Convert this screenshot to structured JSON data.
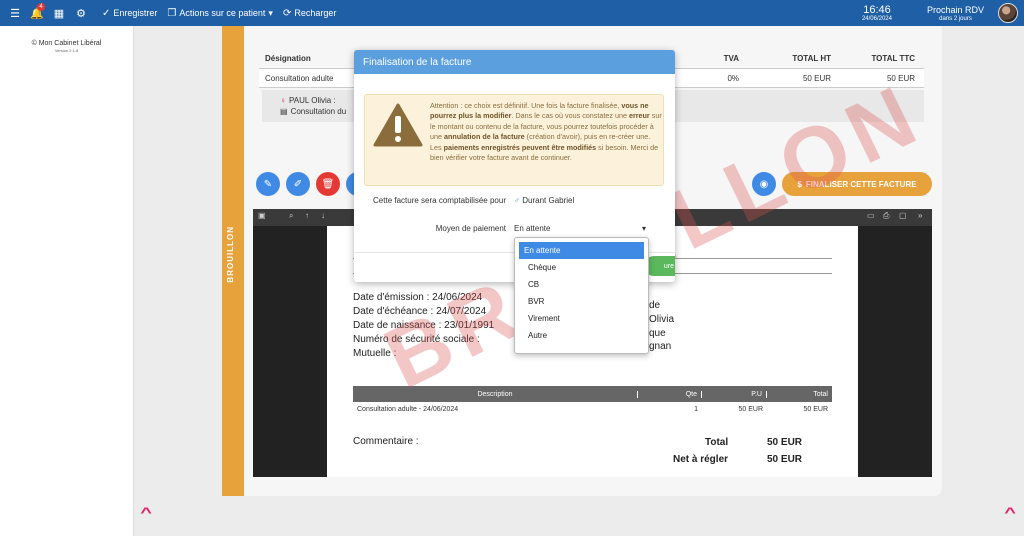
{
  "topbar": {
    "notification_count": "4",
    "save_label": "Enregistrer",
    "actions_label": "Actions sur ce patient",
    "reload_label": "Recharger",
    "time": "16:46",
    "date": "24/06/2024",
    "next_rdv_label": "Prochain RDV",
    "next_rdv_value": "dans 2 jours",
    "icons": [
      "list-icon",
      "bell-icon",
      "calendar-icon",
      "user-settings-icon",
      "check-icon",
      "window-icon",
      "refresh-icon"
    ]
  },
  "sidebar": {
    "brand": "© Mon Cabinet Libéral",
    "version": "Version 2.1.8"
  },
  "page": {
    "status_label": "BROUILLON",
    "table": {
      "headers": [
        "Désignation",
        "TVA",
        "TOTAL HT",
        "TOTAL TTC"
      ],
      "rows": [
        [
          "Consultation adulte",
          "0%",
          "50 EUR",
          "50 EUR"
        ]
      ]
    },
    "detail": {
      "patient": "PAUL Olivia :",
      "item": "Consultation du"
    },
    "finalize_label": "FINALISER CETTE FACTURE"
  },
  "pdf": {
    "emission": "Date d'émission : 24/06/2024",
    "echeance": "Date d'échéance : 24/07/2024",
    "naissance": "Date de naissance : 23/01/1991",
    "secu": "Numéro de sécurité sociale :",
    "mutuelle": "Mutuelle :",
    "right_lines": [
      "de",
      "Olivia",
      "que",
      "gnan"
    ],
    "grid_headers": [
      "Description",
      "Qte",
      "P.U",
      "Total"
    ],
    "grid_row": [
      "Consultation adulte - 24/06/2024",
      "1",
      "50 EUR",
      "50 EUR"
    ],
    "commentaire": "Commentaire :",
    "total_label": "Total",
    "total_value": "50 EUR",
    "net_label": "Net à régler",
    "net_value": "50 EUR",
    "watermark": "BROUILLON"
  },
  "modal": {
    "title": "Finalisation de la facture",
    "warning_parts": {
      "p1": "Attention : ce choix est définitif. Une fois la facture finalisée, ",
      "b1": "vous ne pourrez plus la modifier",
      "p2": ". Dans le cas où vous constatez une ",
      "b2": "erreur",
      "p3": " sur le montant ou contenu de la facture, vous pourrez toutefois procéder à une ",
      "b3": "annulation de la facture",
      "p4": " (création d'avoir), puis en re-créer une. Les ",
      "b4": "paiements enregistrés peuvent être modifiés",
      "p5": " si besoin. Merci de bien vérifier votre facture avant de continuer."
    },
    "accounting_label": "Cette facture sera comptabilisée pour",
    "accounting_value": "Durant Gabriel",
    "payment_label": "Moyen de paiement",
    "payment_value": "En attente",
    "confirm_partial": "ure"
  },
  "dropdown": {
    "options": [
      "En attente",
      "Chèque",
      "CB",
      "BVR",
      "Virement",
      "Autre"
    ],
    "selected_index": 0
  },
  "colors": {
    "topbar": "#1f5fa5",
    "strip": "#e8a23c",
    "modal_header": "#5b9fde",
    "selected": "#3f8ae5"
  }
}
